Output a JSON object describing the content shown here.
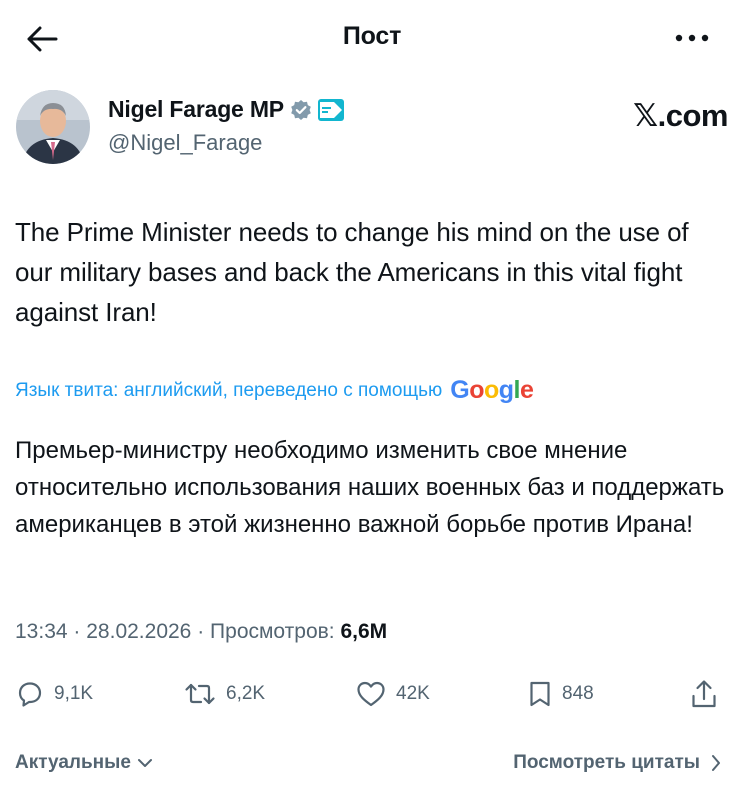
{
  "header": {
    "title": "Пост",
    "back_icon": "arrow-left-icon",
    "more_icon": "more-dots-icon"
  },
  "author": {
    "name": "Nigel Farage MP",
    "handle": "@Nigel_Farage",
    "verified_icon": "verified-badge-icon",
    "affiliation_badge": "reform-uk-badge",
    "affiliation_text": "REFORM UK"
  },
  "watermark": "𝕏.com",
  "tweet": {
    "text": "The Prime Minister needs to change his mind on the use of our military bases and back the Americans in this vital fight against Iran!"
  },
  "translation": {
    "note": "Язык твита: английский, переведено с помощью",
    "provider": "Google",
    "text": "Премьер-министру необходимо изменить свое мнение относительно использования наших военных баз и поддержать американцев в этой жизненно важной борьбе против Ирана!"
  },
  "meta": {
    "time": "13:34",
    "separator": "·",
    "date": "28.02.2026",
    "views_label": "Просмотров:",
    "views_count": "6,6M"
  },
  "actions": {
    "replies": "9,1K",
    "reposts": "6,2K",
    "likes": "42K",
    "bookmarks": "848"
  },
  "bottom": {
    "sort_label": "Актуальные",
    "quotes_label": "Посмотреть цитаты"
  },
  "colors": {
    "text": "#0f1419",
    "secondary": "#536471",
    "link": "#1d9bf0",
    "google_blue": "#4285F4",
    "google_red": "#EA4335",
    "google_yellow": "#FBBC05",
    "google_green": "#34A853"
  }
}
